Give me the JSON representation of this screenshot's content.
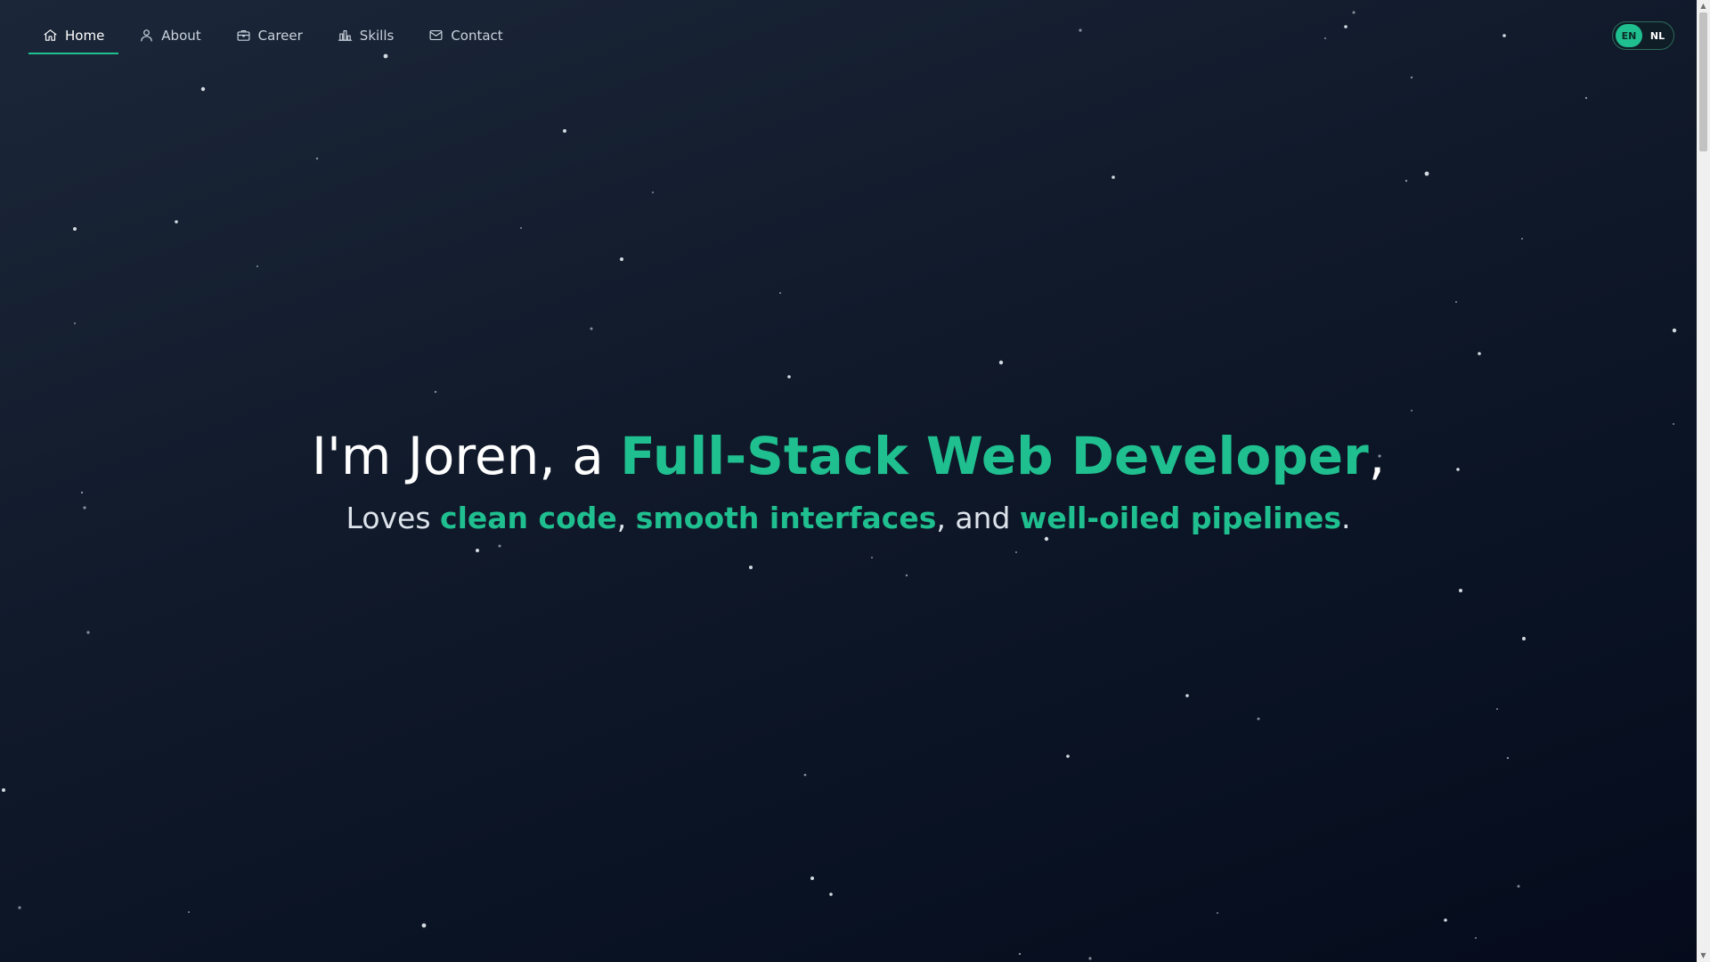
{
  "nav": {
    "items": [
      {
        "label": "Home",
        "icon": "home-icon",
        "active": true
      },
      {
        "label": "About",
        "icon": "user-icon",
        "active": false
      },
      {
        "label": "Career",
        "icon": "briefcase-icon",
        "active": false
      },
      {
        "label": "Skills",
        "icon": "bar-chart-icon",
        "active": false
      },
      {
        "label": "Contact",
        "icon": "mail-icon",
        "active": false
      }
    ]
  },
  "language": {
    "options": [
      "EN",
      "NL"
    ],
    "selected": "EN"
  },
  "hero": {
    "headline_prefix": "I'm Joren, a ",
    "headline_role": "Full-Stack Web Developer",
    "headline_suffix": ",",
    "tagline_prefix": "Loves ",
    "tagline_item_1": "clean code",
    "tagline_sep_1": ", ",
    "tagline_item_2": "smooth interfaces",
    "tagline_sep_2": ", and ",
    "tagline_item_3": "well-oiled pipelines",
    "tagline_suffix": "."
  },
  "colors": {
    "accent": "#1fbf8f",
    "background_top": "#1b2739",
    "background_bottom": "#050b1c",
    "text": "#ffffff"
  }
}
